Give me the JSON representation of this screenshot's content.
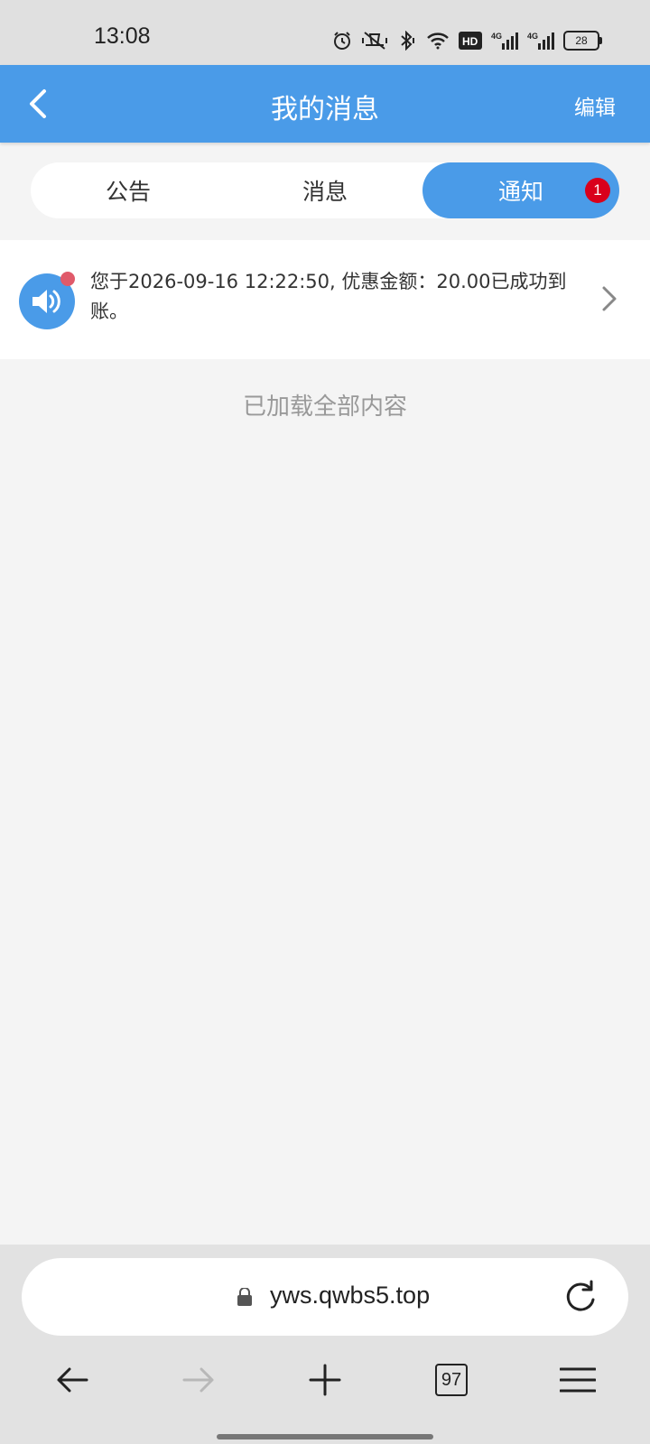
{
  "status_bar": {
    "time": "13:08",
    "battery": "28",
    "icons": [
      "alarm-icon",
      "vibrate-icon",
      "bluetooth-icon",
      "wifi-icon",
      "hd-icon",
      "signal-4g-icon",
      "signal-4g-icon",
      "battery-icon"
    ],
    "hd_label": "HD",
    "network_label": "4G"
  },
  "header": {
    "title": "我的消息",
    "edit_label": "编辑",
    "back_icon": "chevron-left-icon",
    "background_color": "#4a9be8"
  },
  "tabs": [
    {
      "label": "公告",
      "active": false
    },
    {
      "label": "消息",
      "active": false
    },
    {
      "label": "通知",
      "active": true,
      "badge": "1"
    }
  ],
  "messages": [
    {
      "icon": "speaker-icon",
      "unread": true,
      "text": "您于2026-09-16 12:22:50, 优惠金额：20.00已成功到账。"
    }
  ],
  "list_footer": "已加载全部内容",
  "browser": {
    "url": "yws.qwbs5.top",
    "tab_count": "97",
    "nav_icons": [
      "back-arrow-icon",
      "forward-arrow-icon",
      "plus-icon",
      "tabs-icon",
      "menu-icon"
    ]
  },
  "colors": {
    "accent": "#4a9be8",
    "badge": "#d9001b",
    "unread_dot": "#e05a6a"
  }
}
